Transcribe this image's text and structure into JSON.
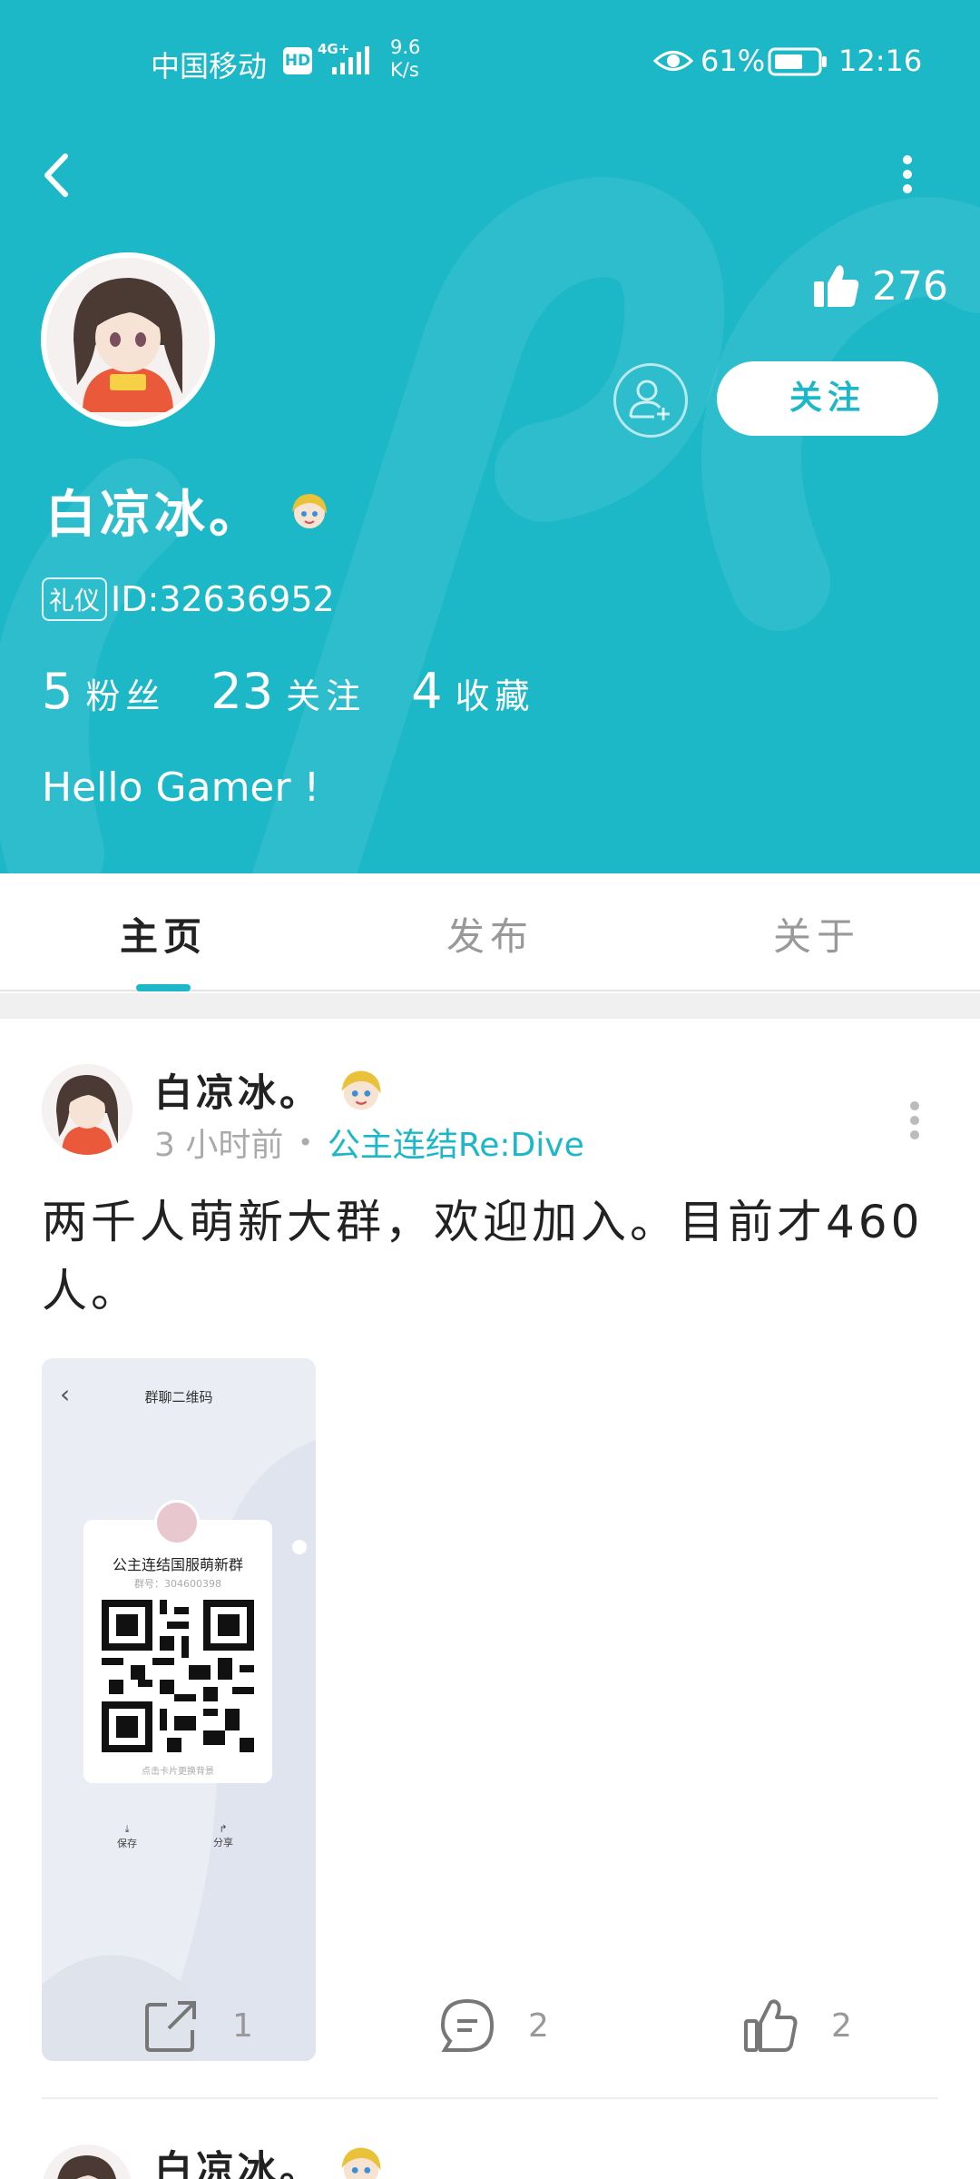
{
  "status_bar": {
    "carrier": "中国移动",
    "hd": "HD",
    "network": "4G+",
    "speed_value": "9.6",
    "speed_unit": "K/s",
    "battery": "61%",
    "time": "12:16"
  },
  "profile": {
    "likes": "276",
    "follow_label": "关注",
    "name": "白凉冰。",
    "tag": "礼仪",
    "id": "ID:32636952",
    "stats": [
      {
        "value": "5",
        "label": "粉丝"
      },
      {
        "value": "23",
        "label": "关注"
      },
      {
        "value": "4",
        "label": "收藏"
      }
    ],
    "bio": "Hello Gamer !"
  },
  "tabs": [
    "主页",
    "发布",
    "关于"
  ],
  "post": {
    "author": "白凉冰。",
    "time": "3 小时前",
    "game": "公主连结Re:Dive",
    "text": "两千人萌新大群，欢迎加入。目前才460人。",
    "image": {
      "title": "群聊二维码",
      "group_name": "公主连结国服萌新群",
      "group_id": "群号：304600398",
      "footer": "点击卡片更换背景",
      "save": "保存",
      "share": "分享"
    },
    "shares": "1",
    "comments": "2",
    "likes": "2"
  },
  "next_post": {
    "author": "白凉冰。"
  },
  "colors": {
    "accent": "#1db8c8"
  }
}
